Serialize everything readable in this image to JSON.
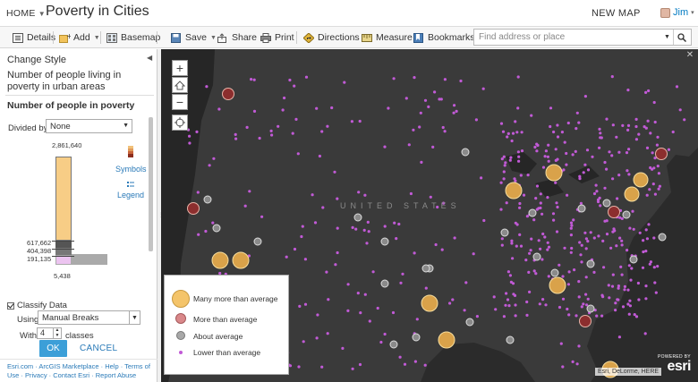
{
  "header": {
    "home_label": "HOME",
    "title": "Poverty in Cities",
    "new_map_label": "NEW MAP",
    "user_name": "Jim"
  },
  "toolbar": {
    "details": "Details",
    "add": "Add",
    "basemap": "Basemap",
    "save": "Save",
    "share": "Share",
    "print": "Print",
    "directions": "Directions",
    "measure": "Measure",
    "bookmarks": "Bookmarks",
    "search_placeholder": "Find address or place"
  },
  "panel": {
    "heading": "Change Style",
    "subtitle": "Number of people living in poverty in urban areas",
    "attribute_title": "Number of people in poverty",
    "divided_by_label": "Divided by",
    "divided_by_value": "None",
    "histogram": {
      "max_label": "2,861,640",
      "break_high": "617,662",
      "break_mid": "404,398",
      "break_low": "191,135",
      "min_label": "5,438"
    },
    "symbols_link": "Symbols",
    "legend_link": "Legend",
    "classify_label": "Classify Data",
    "classify_checked": true,
    "using_label": "Using",
    "using_value": "Manual Breaks",
    "with_label": "With",
    "classes_count": "4",
    "classes_label": "classes",
    "ok_label": "OK",
    "cancel_label": "CANCEL",
    "footer_text": "Esri.com · ArcGIS Marketplace · Help · Terms of Use · Privacy · Contact Esri · Report Abuse"
  },
  "map": {
    "country_label": "UNITED STATES",
    "attribution": "Esri, DeLorme, HERE",
    "powered_by": "POWERED BY",
    "brand": "esri"
  },
  "legend": {
    "items": [
      {
        "label": "Many more than average",
        "color": "#f4c46a"
      },
      {
        "label": "More than average",
        "color": "#d9888a"
      },
      {
        "label": "About average",
        "color": "#a8a8a8"
      },
      {
        "label": "Lower than average",
        "color": "#c15ad6"
      }
    ]
  },
  "colors": {
    "accent": "#3c9fd8",
    "link": "#2a7ab8",
    "map_background": "#2b2b2b"
  }
}
